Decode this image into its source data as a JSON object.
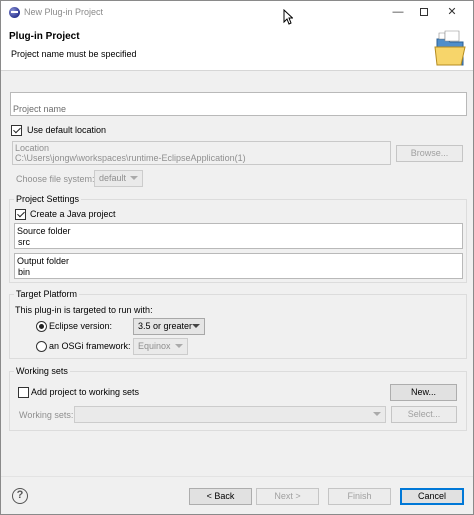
{
  "window": {
    "title": "New Plug-in Project",
    "minimize_glyph": "—",
    "close_glyph": "✕"
  },
  "header": {
    "title": "Plug-in Project",
    "message": "Project name must be specified"
  },
  "project_name": {
    "placeholder": "Project name",
    "value": ""
  },
  "location": {
    "use_default_label": "Use default location",
    "use_default_checked": true,
    "label": "Location",
    "value": "C:\\Users\\jongw\\workspaces\\runtime-EclipseApplication(1)",
    "browse_label": "Browse...",
    "file_system_label": "Choose file system:",
    "file_system_value": "default"
  },
  "project_settings": {
    "group_label": "Project Settings",
    "create_java_label": "Create a Java project",
    "create_java_checked": true,
    "source_folder_label": "Source folder",
    "source_folder_value": "src",
    "output_folder_label": "Output folder",
    "output_folder_value": "bin"
  },
  "target_platform": {
    "group_label": "Target Platform",
    "description": "This plug-in is targeted to run with:",
    "eclipse_label": "Eclipse version:",
    "eclipse_selected": true,
    "eclipse_version": "3.5 or greater",
    "osgi_label": "an OSGi framework:",
    "osgi_value": "Equinox"
  },
  "working_sets": {
    "group_label": "Working sets",
    "add_label": "Add project to working sets",
    "add_checked": false,
    "new_label": "New...",
    "sets_label": "Working sets:",
    "select_label": "Select..."
  },
  "footer": {
    "help_glyph": "?",
    "back_label": "< Back",
    "next_label": "Next >",
    "finish_label": "Finish",
    "cancel_label": "Cancel"
  },
  "colors": {
    "accent": "#0078d7",
    "background": "#f0f0f0"
  }
}
